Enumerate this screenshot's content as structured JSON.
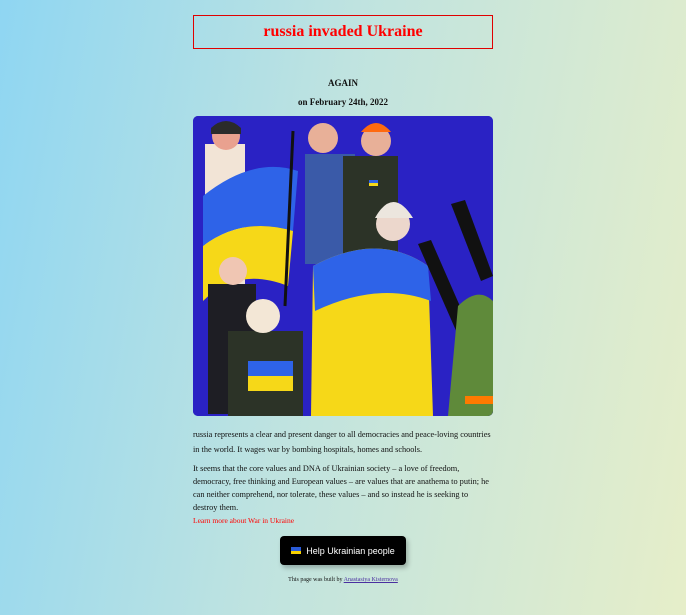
{
  "header": {
    "title": "russia invaded Ukraine"
  },
  "intro": {
    "again": "AGAIN",
    "date": "on February 24th, 2022"
  },
  "illustration": {
    "alt": "people-with-ukrainian-flag-illustration"
  },
  "body": {
    "paragraph1": "russia represents a clear and present danger to all democracies and peace-loving countries in the world. It wages war by bombing hospitals, homes and schools.",
    "paragraph2": "It seems that the core values and DNA of Ukrainian society – a love of freedom, democracy, free thinking and European values – are values that are anathema to putin; he can neither comprehend, nor tolerate, these values – and so instead he is seeking to destroy them.",
    "learn_more": "Learn more about War in Ukraine"
  },
  "cta": {
    "label": "Help Ukrainian people",
    "icon": "ukraine-flag-icon"
  },
  "footer": {
    "prefix": "This page was built by ",
    "author": "Anastasiya Kisternova"
  },
  "colors": {
    "accent": "#ff0000",
    "flag_blue": "#2a5bd7",
    "flag_yellow": "#f5d000",
    "button_bg": "#000000"
  }
}
